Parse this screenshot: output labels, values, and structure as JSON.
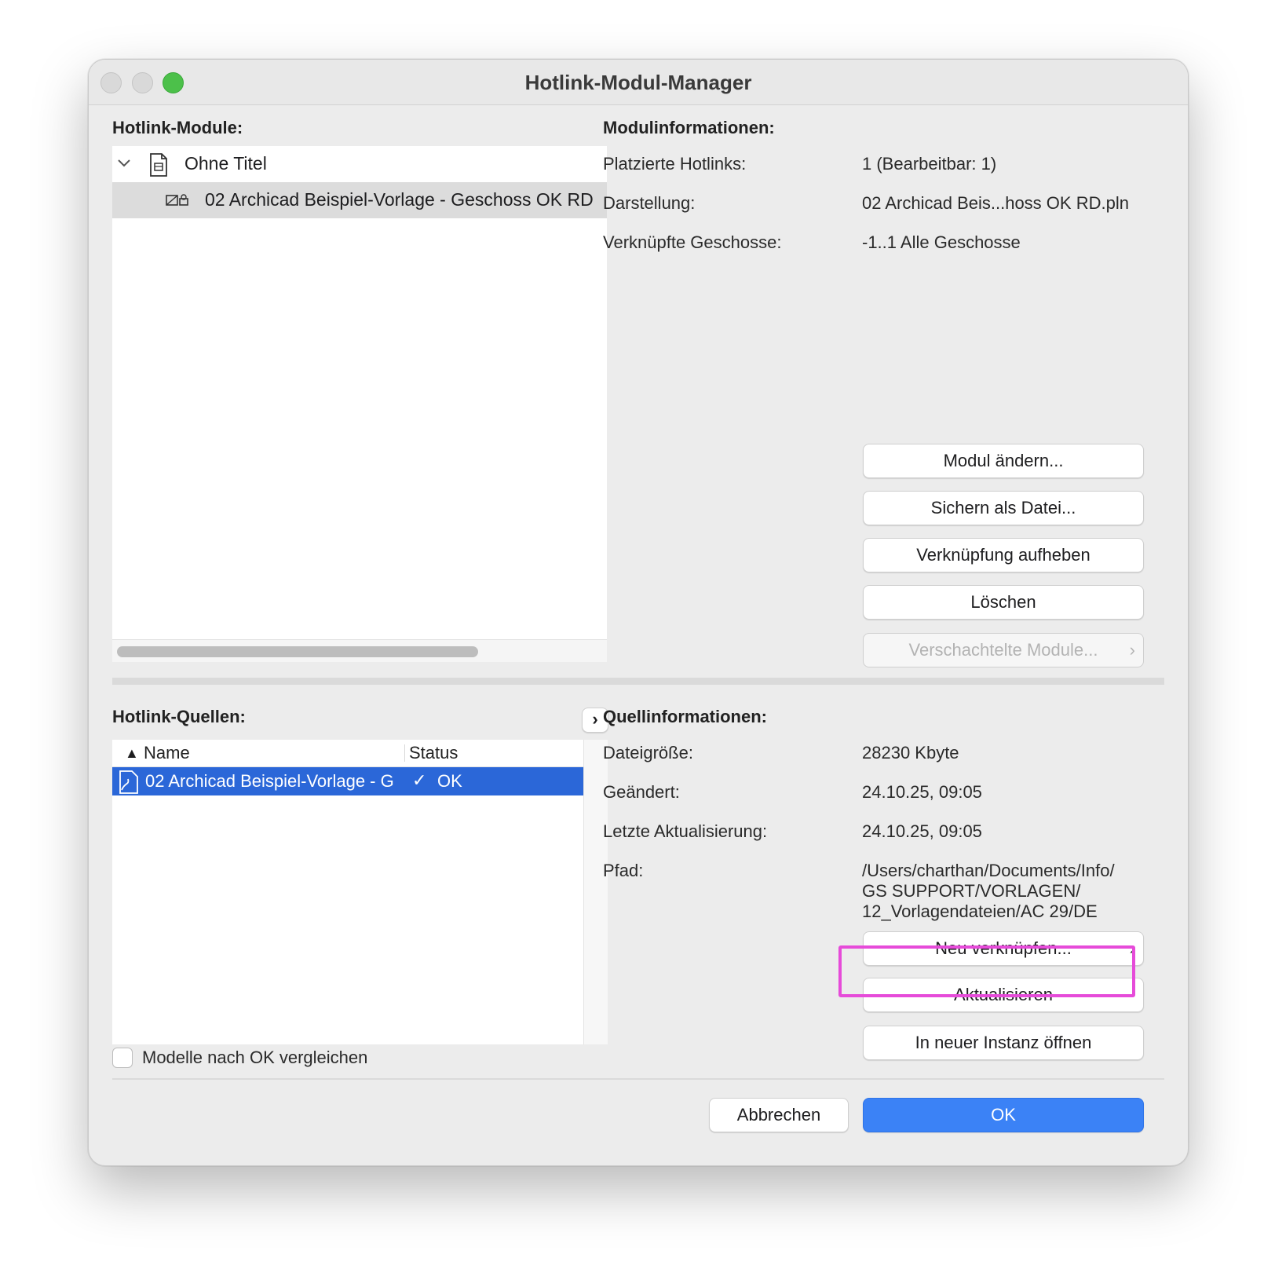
{
  "window": {
    "title": "Hotlink-Modul-Manager"
  },
  "modules": {
    "label": "Hotlink-Module:",
    "tree": [
      {
        "label": "Ohne Titel",
        "icon": "document-icon"
      },
      {
        "label": "02 Archicad Beispiel-Vorlage - Geschoss OK RD",
        "icon": "hotlink-module-icon"
      }
    ]
  },
  "module_info": {
    "label": "Modulinformationen:",
    "rows": [
      {
        "label": "Platzierte Hotlinks:",
        "value": "1 (Bearbeitbar: 1)"
      },
      {
        "label": "Darstellung:",
        "value": "02 Archicad Beis...hoss OK RD.pln"
      },
      {
        "label": "Verknüpfte Geschosse:",
        "value": "-1..1 Alle Geschosse"
      }
    ],
    "buttons": {
      "change": "Modul ändern...",
      "save": "Sichern als Datei...",
      "unlink": "Verknüpfung aufheben",
      "delete": "Löschen",
      "nested": "Verschachtelte Module..."
    }
  },
  "sources": {
    "label": "Hotlink-Quellen:",
    "expand_icon": "chevron-right-icon",
    "columns": {
      "name": "Name",
      "status": "Status"
    },
    "rows": [
      {
        "name": "02 Archicad Beispiel-Vorlage - G",
        "status": "OK"
      }
    ],
    "compare_checkbox": {
      "label": "Modelle nach OK vergleichen",
      "checked": false
    }
  },
  "source_info": {
    "label": "Quellinformationen:",
    "rows": [
      {
        "label": "Dateigröße:",
        "value": "28230 Kbyte"
      },
      {
        "label": "Geändert:",
        "value": "24.10.25, 09:05"
      },
      {
        "label": "Letzte Aktualisierung:",
        "value": "24.10.25, 09:05"
      }
    ],
    "path_label": "Pfad:",
    "path_lines": [
      "/Users/charthan/Documents/Info/",
      "GS SUPPORT/VORLAGEN/",
      "12_Vorlagendateien/AC 29/DE"
    ],
    "buttons": {
      "relink": "Neu verknüpfen...",
      "update": "Aktualisieren",
      "open_instance": "In neuer Instanz öffnen"
    }
  },
  "footer": {
    "cancel": "Abbrechen",
    "ok": "OK"
  },
  "colors": {
    "accent": "#3b82f6",
    "selection": "#2b67d8",
    "highlight": "#e64bd9"
  }
}
